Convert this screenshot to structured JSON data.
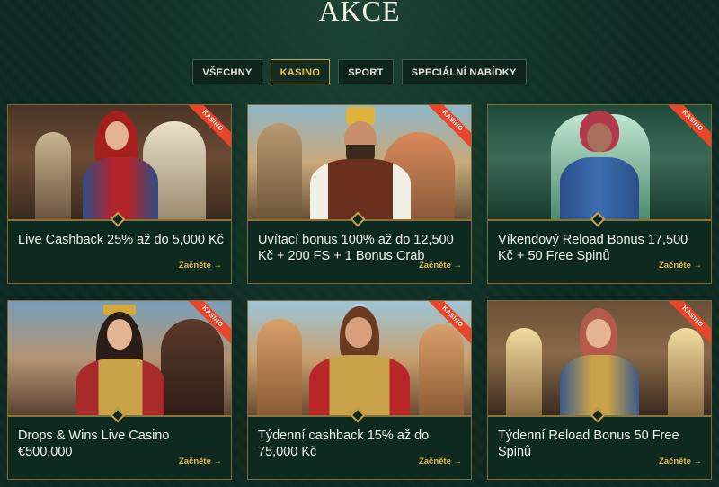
{
  "page": {
    "title": "AKCE"
  },
  "filters": [
    {
      "label": "VŠECHNY",
      "active": false
    },
    {
      "label": "KASINO",
      "active": true
    },
    {
      "label": "SPORT",
      "active": false
    },
    {
      "label": "SPECIÁLNÍ NABÍDKY",
      "active": false
    }
  ],
  "cards": [
    {
      "name": "Live Cashback 25% až do 5,000 Kč",
      "cta": "Začněte →",
      "badge": "KASINO"
    },
    {
      "name": "Uvítací bonus 100% až do 12,500 Kč + 200 FS + 1 Bonus Crab",
      "cta": "Začněte →",
      "badge": "KASINO"
    },
    {
      "name": "Víkendový Reload Bonus 17,500 Kč + 50 Free Spinů",
      "cta": "Začněte →",
      "badge": "KASINO"
    },
    {
      "name": "Drops & Wins Live Casino €500,000",
      "cta": "Začněte →",
      "badge": "KASINO"
    },
    {
      "name": "Týdenní cashback 15% až do 75,000 Kč",
      "cta": "Začněte →",
      "badge": "KASINO"
    },
    {
      "name": "Týdenní Reload Bonus 50 Free Spinů",
      "cta": "Začněte →",
      "badge": "KASINO"
    }
  ],
  "colors": {
    "accent": "#c8a24a",
    "cta": "#e3b84f",
    "ribbon": "#e8452a",
    "background": "#0d2a22"
  }
}
